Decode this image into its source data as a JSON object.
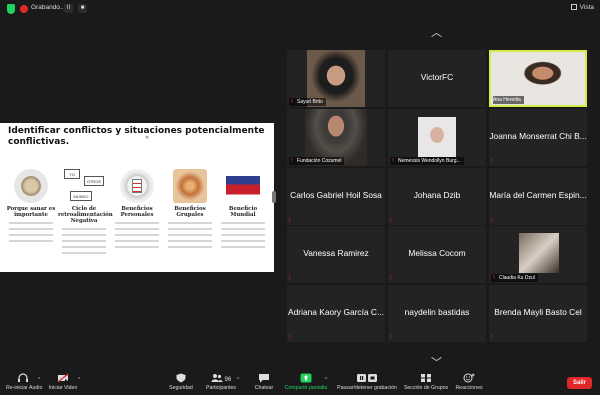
{
  "topbar": {
    "recording_label": "Grabando...",
    "pause_glyph": "II",
    "stop_glyph": "■",
    "view_label": "Vista"
  },
  "share": {
    "title": "Identificar conflictos y situaciones potencialmente conflictivas.",
    "columns": [
      {
        "title": "Porque sanar es importante",
        "sub": ""
      },
      {
        "title": "Ciclo de retroalimentación Negativa",
        "sub": "",
        "labels": [
          "YO",
          "OTROS",
          "MUNDO"
        ]
      },
      {
        "title": "Beneficios Personales",
        "sub": ""
      },
      {
        "title": "Beneficios Grupales",
        "sub": ""
      },
      {
        "title": "Beneficio Mundial",
        "sub": ""
      }
    ]
  },
  "participants": [
    {
      "name": "Sayuri Brito",
      "has_video": true,
      "muted": true
    },
    {
      "name": "VictorFC",
      "has_video": false,
      "muted": false
    },
    {
      "name": "Ana Heredia",
      "has_video": true,
      "muted": false,
      "active": true
    },
    {
      "name": "Fundación Cozumel",
      "has_video": true,
      "muted": true
    },
    {
      "name": "Nemessis Wendollyn Burg...",
      "has_video": true,
      "muted": true
    },
    {
      "name": "Joanna Monserrat Chi B...",
      "has_video": false,
      "muted": true
    },
    {
      "name": "Carlos Gabriel Hoil Sosa",
      "has_video": false,
      "muted": true
    },
    {
      "name": "Johana Dzib",
      "has_video": false,
      "muted": true
    },
    {
      "name": "María del Carmen Espin...",
      "has_video": false,
      "muted": true
    },
    {
      "name": "Vanessa Ramirez",
      "has_video": false,
      "muted": true
    },
    {
      "name": "Melissa Cocom",
      "has_video": false,
      "muted": true
    },
    {
      "name": "Claudia Ku Dzul",
      "has_video": true,
      "muted": true
    },
    {
      "name": "Adriana Kaory García C...",
      "has_video": false,
      "muted": true
    },
    {
      "name": "naydelin bastidas",
      "has_video": false,
      "muted": true
    },
    {
      "name": "Brenda Mayli Basto Cel",
      "has_video": false,
      "muted": true
    }
  ],
  "toolbar": {
    "audio": "Re-iniciar Audio",
    "video": "Iniciar Video",
    "security": "Seguridad",
    "participants": "Participantes",
    "participants_count": "96",
    "chat": "Chatear",
    "share": "Compartir pantalla",
    "record": "Pausar/detener grabación",
    "breakout": "Sección de Grupos",
    "reactions": "Reacciones",
    "leave": "Salir"
  },
  "colors": {
    "background": "#1a1a1a",
    "tile": "#232323",
    "active_border": "#d6e94a",
    "muted_red": "#e02828",
    "share_green": "#23d160",
    "leave_red": "#e02828"
  }
}
